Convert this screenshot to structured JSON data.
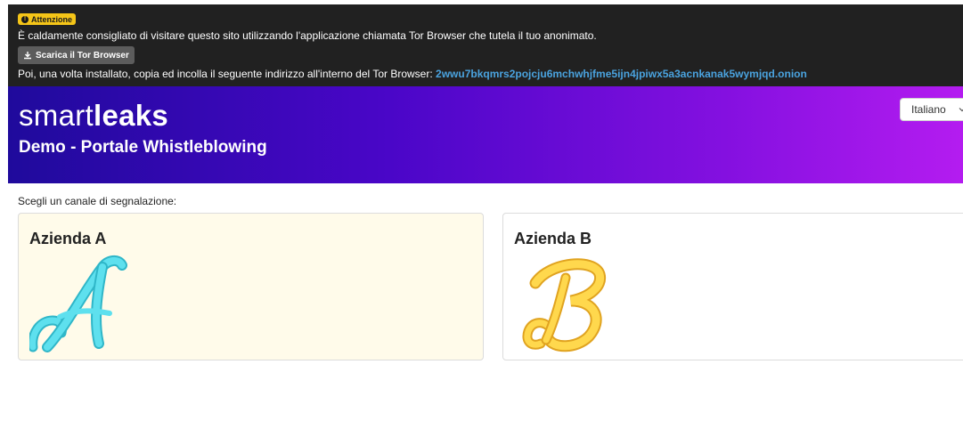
{
  "banner": {
    "badge": "Attenzione",
    "badge_icon": "info-icon",
    "message": "È caldamente consigliato di visitare questo sito utilizzando l'applicazione chiamata Tor Browser che tutela il tuo anonimato.",
    "download_button": "Scarica il Tor Browser",
    "download_icon": "download-icon",
    "instruction": "Poi, una volta installato, copia ed incolla il seguente indirizzo all'interno del Tor Browser:",
    "onion_address": "2wwu7bkqmrs2pojcju6mchwhjfme5ijn4jpiwx5a3acnkanak5wymjqd.onion"
  },
  "header": {
    "logo_light": "smart",
    "logo_bold": "leaks",
    "subtitle": "Demo - Portale Whistleblowing",
    "language": "Italiano"
  },
  "main": {
    "prompt": "Scegli un canale di segnalazione:",
    "channels": [
      {
        "name": "Azienda A",
        "logo": "letter-a-logo",
        "color": "#4fd3e3",
        "background": "#fffbea"
      },
      {
        "name": "Azienda B",
        "logo": "letter-b-logo",
        "color": "#f7c734",
        "background": "#ffffff"
      }
    ]
  },
  "colors": {
    "banner_bg": "#212121",
    "badge": "#f5c518",
    "onion_link": "#4aa3df",
    "header_gradient_start": "#1f0a9c",
    "header_gradient_end": "#b41cf0"
  }
}
